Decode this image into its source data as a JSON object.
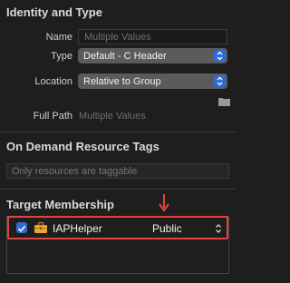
{
  "identity": {
    "title": "Identity and Type",
    "name_label": "Name",
    "name_placeholder": "Multiple Values",
    "type_label": "Type",
    "type_value": "Default - C Header",
    "location_label": "Location",
    "location_value": "Relative to Group",
    "fullpath_label": "Full Path",
    "fullpath_value": "Multiple Values"
  },
  "on_demand": {
    "title": "On Demand Resource Tags",
    "placeholder": "Only resources are taggable"
  },
  "membership": {
    "title": "Target Membership",
    "targets": [
      {
        "name": "IAPHelper",
        "checked": true,
        "access": "Public"
      }
    ]
  },
  "colors": {
    "accent": "#2f6cd7",
    "highlight": "#e0463e"
  }
}
